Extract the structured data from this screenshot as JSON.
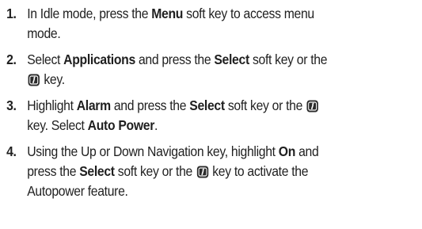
{
  "steps": [
    {
      "number": "1.",
      "lines": [
        [
          {
            "t": "In Idle mode, press the "
          },
          {
            "t": "Menu",
            "b": true
          },
          {
            "t": " soft key to access menu"
          }
        ],
        [
          {
            "t": "mode."
          }
        ]
      ]
    },
    {
      "number": "2.",
      "lines": [
        [
          {
            "t": "Select "
          },
          {
            "t": "Applications",
            "b": true
          },
          {
            "t": " and press the "
          },
          {
            "t": "Select",
            "b": true
          },
          {
            "t": " soft key or the"
          }
        ],
        [
          {
            "icon": "info-key-icon"
          },
          {
            "t": " key."
          }
        ]
      ]
    },
    {
      "number": "3.",
      "lines": [
        [
          {
            "t": "Highlight "
          },
          {
            "t": "Alarm",
            "b": true
          },
          {
            "t": " and press the "
          },
          {
            "t": "Select",
            "b": true
          },
          {
            "t": " soft key or the "
          },
          {
            "icon": "info-key-icon"
          }
        ],
        [
          {
            "t": "key. Select "
          },
          {
            "t": "Auto Power",
            "b": true
          },
          {
            "t": "."
          }
        ]
      ]
    },
    {
      "number": "4.",
      "lines": [
        [
          {
            "t": "Using the Up or Down Navigation key, highlight "
          },
          {
            "t": "On",
            "b": true
          },
          {
            "t": " and"
          }
        ],
        [
          {
            "t": "press the "
          },
          {
            "t": "Select",
            "b": true
          },
          {
            "t": " soft key or the "
          },
          {
            "icon": "info-key-icon"
          },
          {
            "t": " key to activate the"
          }
        ],
        [
          {
            "t": "Autopower feature."
          }
        ]
      ]
    }
  ],
  "colors": {
    "text": "#1f1f1f",
    "key_icon_fill": "#2b2b2b",
    "key_icon_glyph": "#ffffff"
  }
}
